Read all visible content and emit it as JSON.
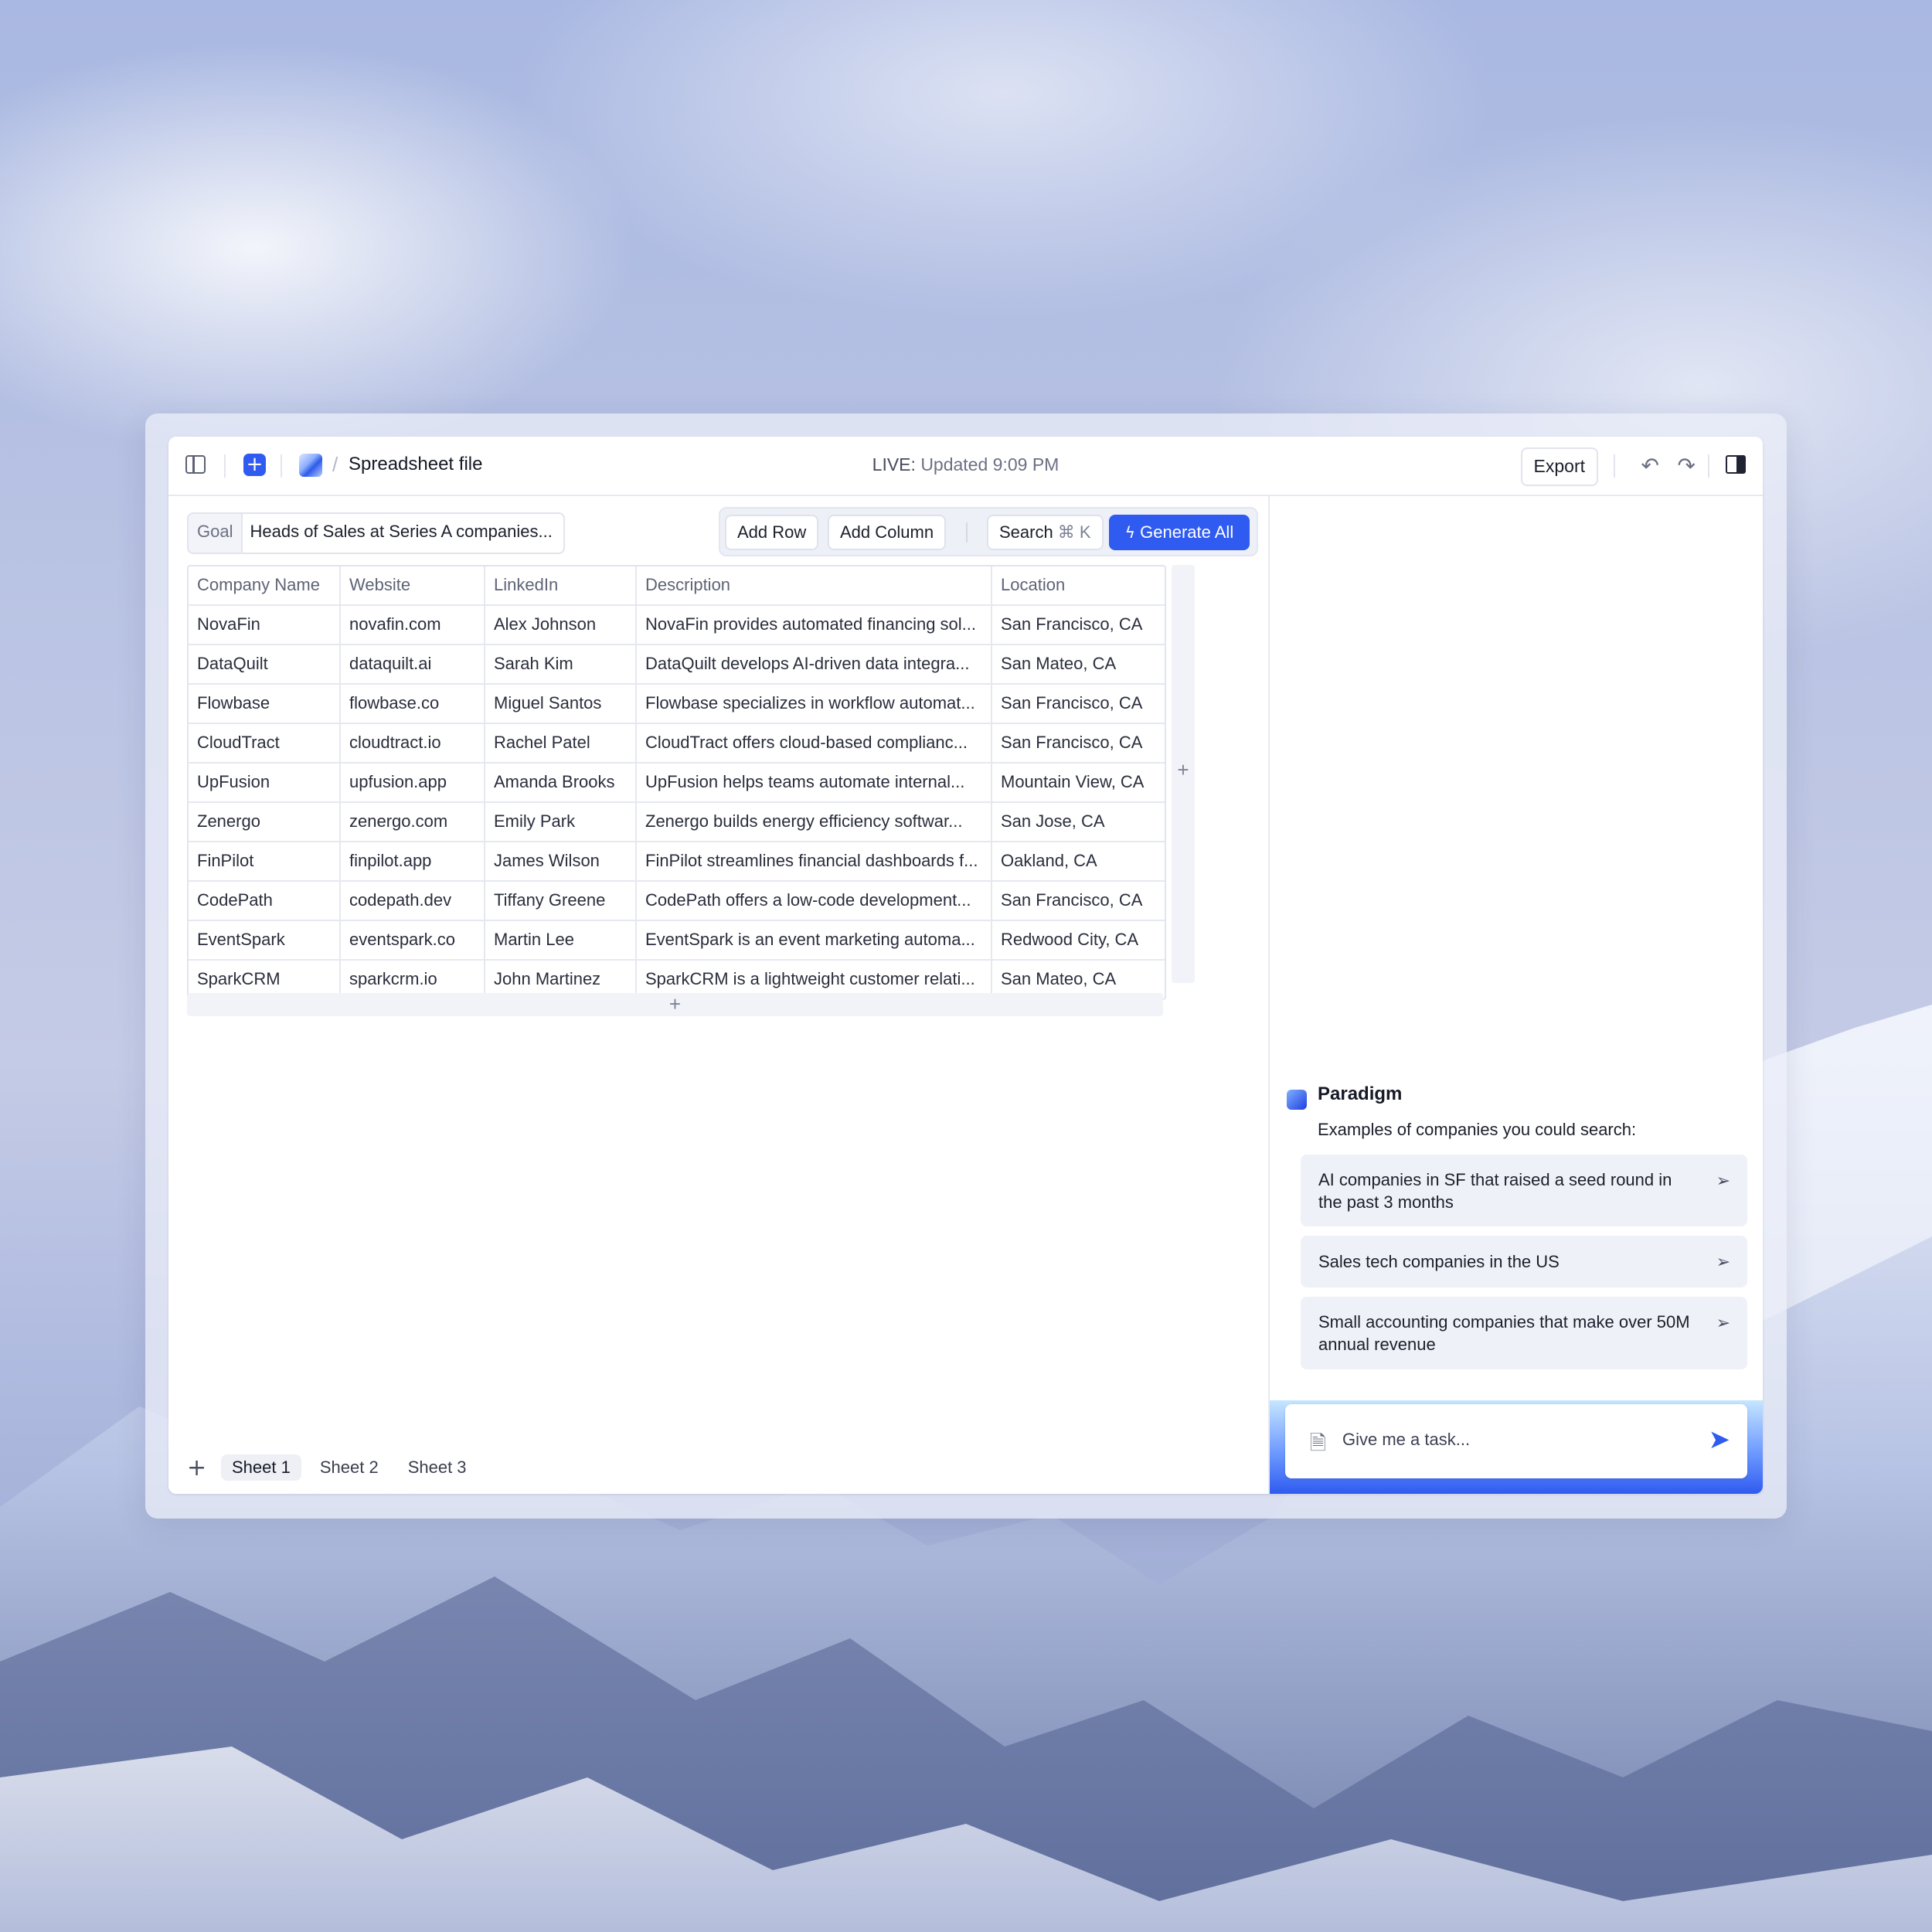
{
  "window": {
    "file_title": "Spreadsheet file",
    "live_label": "LIVE:",
    "live_status": "Updated 9:09 PM",
    "export_label": "Export"
  },
  "icons": {
    "sidebar_toggle": "sidebar-toggle-icon",
    "new": "plus-icon",
    "app_logo": "app-logo",
    "undo": "undo-icon",
    "redo": "redo-icon",
    "panel_toggle": "right-panel-icon",
    "generate": "lightning-icon",
    "send": "send-icon",
    "attach": "document-icon"
  },
  "toolbar": {
    "goal_label": "Goal",
    "goal_value": "Heads of Sales at Series A companies...",
    "add_row": "Add Row",
    "add_column": "Add Column",
    "search": "Search",
    "search_shortcut": "⌘ K",
    "generate_all": "Generate All"
  },
  "table": {
    "columns": [
      "Company Name",
      "Website",
      "LinkedIn",
      "Description",
      "Location"
    ],
    "rows": [
      [
        "NovaFin",
        "novafin.com",
        "Alex Johnson",
        "NovaFin provides automated financing sol...",
        "San Francisco, CA"
      ],
      [
        "DataQuilt",
        "dataquilt.ai",
        "Sarah Kim",
        "DataQuilt develops AI-driven data integra...",
        "San Mateo, CA"
      ],
      [
        "Flowbase",
        "flowbase.co",
        "Miguel Santos",
        "Flowbase specializes in workflow automat...",
        "San Francisco, CA"
      ],
      [
        "CloudTract",
        "cloudtract.io",
        "Rachel Patel",
        "CloudTract offers cloud-based complianc...",
        "San Francisco, CA"
      ],
      [
        "UpFusion",
        "upfusion.app",
        "Amanda Brooks",
        "UpFusion helps teams automate internal...",
        "Mountain View, CA"
      ],
      [
        "Zenergo",
        "zenergo.com",
        "Emily Park",
        "Zenergo builds energy efficiency softwar...",
        "San Jose, CA"
      ],
      [
        "FinPilot",
        "finpilot.app",
        "James Wilson",
        "FinPilot streamlines financial dashboards f...",
        "Oakland, CA"
      ],
      [
        "CodePath",
        "codepath.dev",
        "Tiffany Greene",
        "CodePath offers a low-code development...",
        "San Francisco, CA"
      ],
      [
        "EventSpark",
        "eventspark.co",
        "Martin Lee",
        "EventSpark is an event marketing automa...",
        "Redwood City, CA"
      ],
      [
        "SparkCRM",
        "sparkcrm.io",
        "John Martinez",
        "SparkCRM is a lightweight customer relati...",
        "San Mateo, CA"
      ]
    ],
    "add_symbol": "+"
  },
  "sheets": {
    "add_symbol": "+",
    "tabs": [
      "Sheet 1",
      "Sheet 2",
      "Sheet 3"
    ],
    "active": "Sheet 1"
  },
  "assistant": {
    "name": "Paradigm",
    "intro": "Examples of companies you could search:",
    "suggestions": [
      "AI companies in SF that raised a seed round in the past 3 months",
      "Sales tech companies in the US",
      "Small accounting companies that make over 50M annual revenue"
    ],
    "input_placeholder": "Give me a task..."
  },
  "colors": {
    "accent": "#2f5bf0",
    "panel_bg": "#eff1f8"
  }
}
